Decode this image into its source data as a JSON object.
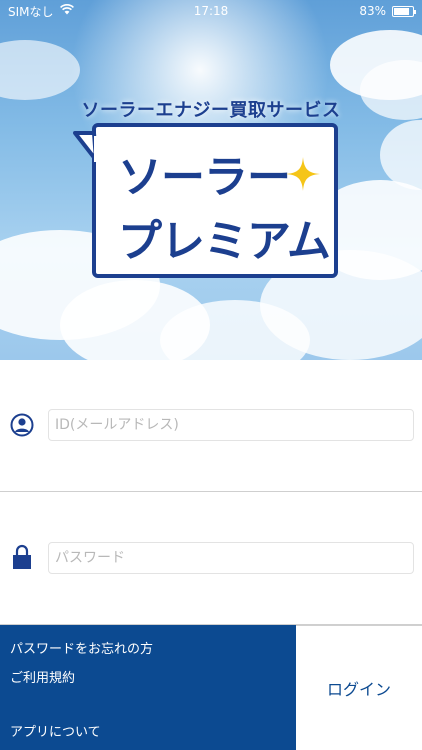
{
  "status_bar": {
    "carrier": "SIMなし",
    "time": "17:18",
    "battery_percent_label": "83%",
    "battery_level": 0.83
  },
  "logo": {
    "subtitle": "ソーラーエナジー買取サービス",
    "title_line1": "ソーラー",
    "title_line2": "プレミアム"
  },
  "form": {
    "id_placeholder": "ID(メールアドレス)",
    "id_value": "",
    "password_placeholder": "パスワード",
    "password_value": ""
  },
  "links": {
    "forgot_password": "パスワードをお忘れの方",
    "terms": "ご利用規約",
    "about": "アプリについて"
  },
  "login_button": "ログイン",
  "colors": {
    "brand_blue": "#1c3f8f",
    "footer_blue": "#0c4a91",
    "sparkle": "#f5c518"
  },
  "icons": [
    "wifi-icon",
    "battery-icon",
    "user-icon",
    "lock-icon",
    "sparkle-icon"
  ]
}
